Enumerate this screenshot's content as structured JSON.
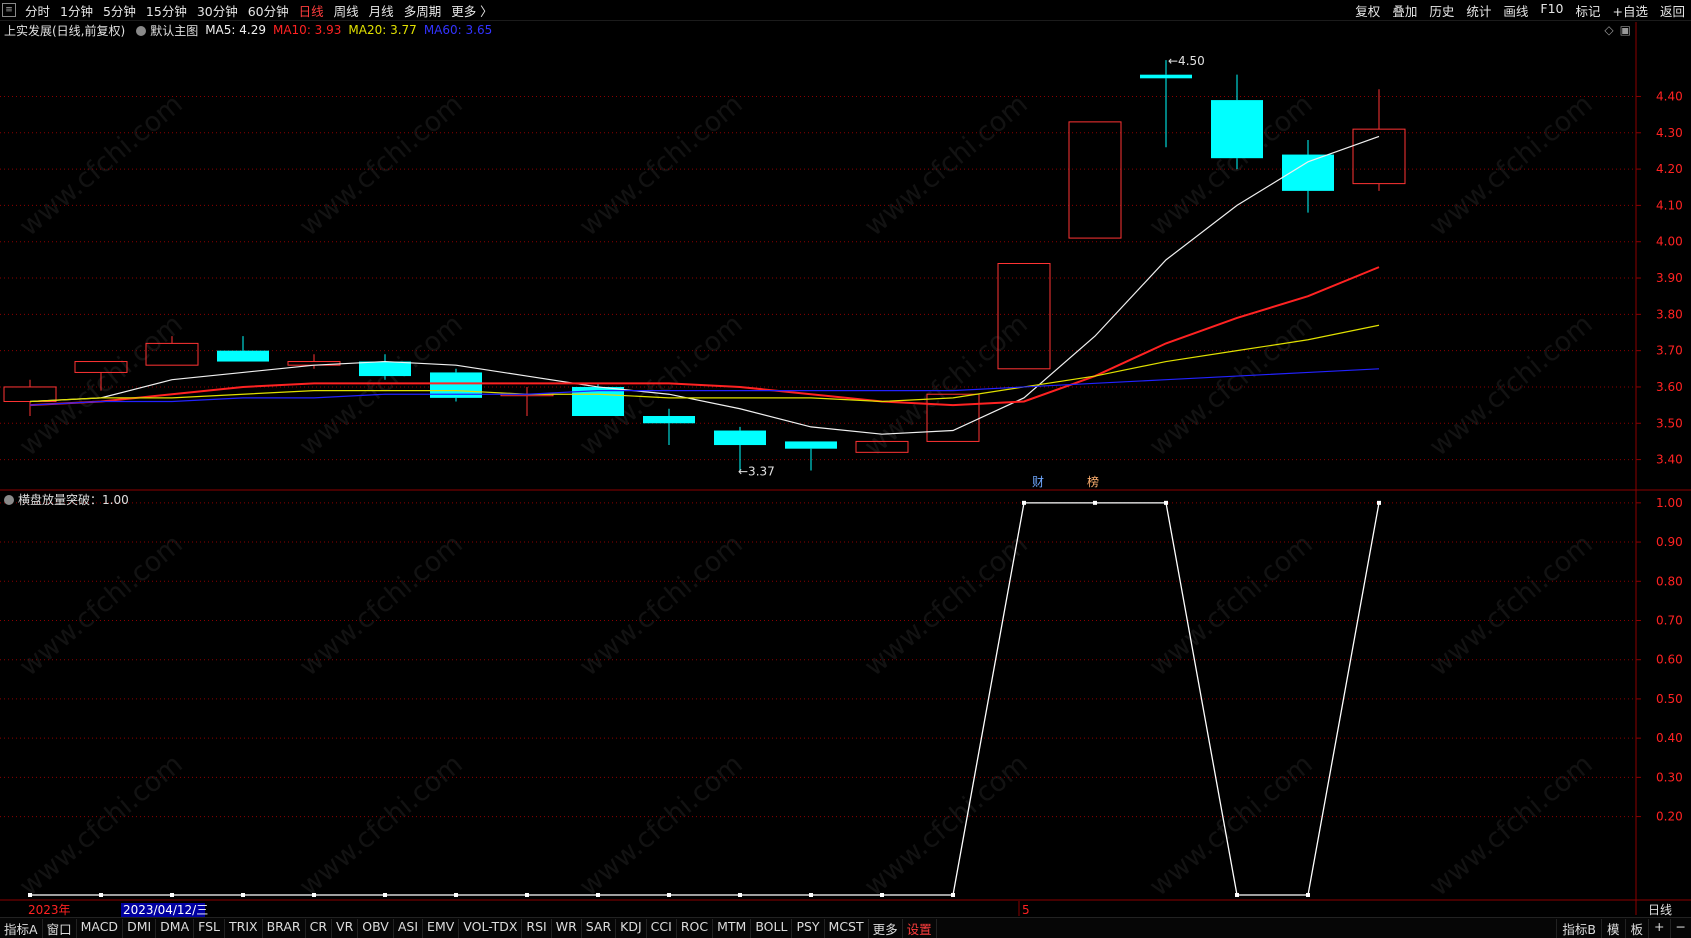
{
  "topbar": {
    "sys_icon": "menu-icon",
    "periods": [
      "分时",
      "1分钟",
      "5分钟",
      "15分钟",
      "30分钟",
      "60分钟",
      "日线",
      "周线",
      "月线",
      "多周期",
      "更多 〉"
    ],
    "active_period": "日线",
    "right_items": [
      "复权",
      "叠加",
      "历史",
      "统计",
      "画线",
      "F10",
      "标记",
      "+自选",
      "返回"
    ]
  },
  "legend": {
    "title": "上实发展(日线,前复权)",
    "main_label": "默认主图",
    "ma5": "MA5: 4.29",
    "ma10": "MA10: 3.93",
    "ma20": "MA20: 3.77",
    "ma60": "MA60: 3.65"
  },
  "indicator_legend": {
    "label": "横盘放量突破：1.00"
  },
  "markers": {
    "high_label": "4.50",
    "low_label": "3.37",
    "event1": "财",
    "event2": "榜"
  },
  "xaxis": {
    "year_label": "2023年",
    "date_label": "2023/04/12/三",
    "tick5": "5",
    "period_label": "日线"
  },
  "bottombar": {
    "tabs": [
      "指标A",
      "窗口",
      "MACD",
      "DMI",
      "DMA",
      "FSL",
      "TRIX",
      "BRAR",
      "CR",
      "VR",
      "OBV",
      "ASI",
      "EMV",
      "VOL-TDX",
      "RSI",
      "WR",
      "SAR",
      "KDJ",
      "CCI",
      "ROC",
      "MTM",
      "BOLL",
      "PSY",
      "MCST",
      "更多",
      "设置"
    ],
    "active_tab": "设置",
    "right_tabs": [
      "指标B",
      "模",
      "板",
      "+",
      "−"
    ]
  },
  "colors": {
    "up": "#ff3333",
    "down": "#00ffff",
    "ma5": "#f0f0f0",
    "ma10": "#ff2222",
    "ma20": "#e0e000",
    "ma60": "#2222ff",
    "grid": "#8b0000",
    "indicator": "#ffffff"
  },
  "watermark": "www.cfchi.com",
  "chart_data": [
    {
      "type": "candlestick",
      "ylim": [
        3.33,
        4.55
      ],
      "y_ticks": [
        3.4,
        3.5,
        3.6,
        3.7,
        3.8,
        3.9,
        4.0,
        4.1,
        4.2,
        4.3,
        4.4
      ],
      "candles": [
        {
          "o": 3.56,
          "h": 3.62,
          "l": 3.52,
          "c": 3.6
        },
        {
          "o": 3.64,
          "h": 3.67,
          "l": 3.59,
          "c": 3.67
        },
        {
          "o": 3.66,
          "h": 3.74,
          "l": 3.66,
          "c": 3.72
        },
        {
          "o": 3.7,
          "h": 3.74,
          "l": 3.68,
          "c": 3.67
        },
        {
          "o": 3.66,
          "h": 3.69,
          "l": 3.65,
          "c": 3.67
        },
        {
          "o": 3.67,
          "h": 3.69,
          "l": 3.62,
          "c": 3.63
        },
        {
          "o": 3.64,
          "h": 3.65,
          "l": 3.56,
          "c": 3.57
        },
        {
          "o": 3.58,
          "h": 3.6,
          "l": 3.52,
          "c": 3.58
        },
        {
          "o": 3.6,
          "h": 3.61,
          "l": 3.52,
          "c": 3.52
        },
        {
          "o": 3.52,
          "h": 3.54,
          "l": 3.44,
          "c": 3.5
        },
        {
          "o": 3.48,
          "h": 3.49,
          "l": 3.37,
          "c": 3.44
        },
        {
          "o": 3.45,
          "h": 3.45,
          "l": 3.37,
          "c": 3.43
        },
        {
          "o": 3.42,
          "h": 3.45,
          "l": 3.42,
          "c": 3.45
        },
        {
          "o": 3.45,
          "h": 3.58,
          "l": 3.45,
          "c": 3.58
        },
        {
          "o": 3.65,
          "h": 3.94,
          "l": 3.65,
          "c": 3.94
        },
        {
          "o": 4.01,
          "h": 4.33,
          "l": 4.01,
          "c": 4.33
        },
        {
          "o": 4.46,
          "h": 4.5,
          "l": 4.26,
          "c": 4.45
        },
        {
          "o": 4.39,
          "h": 4.46,
          "l": 4.2,
          "c": 4.23
        },
        {
          "o": 4.24,
          "h": 4.28,
          "l": 4.08,
          "c": 4.14
        },
        {
          "o": 4.16,
          "h": 4.42,
          "l": 4.14,
          "c": 4.31
        }
      ],
      "series": [
        {
          "name": "MA5",
          "values": [
            3.56,
            3.57,
            3.62,
            3.64,
            3.66,
            3.67,
            3.66,
            3.63,
            3.6,
            3.58,
            3.54,
            3.49,
            3.47,
            3.48,
            3.57,
            3.74,
            3.95,
            4.1,
            4.22,
            4.29
          ]
        },
        {
          "name": "MA10",
          "values": [
            3.55,
            3.56,
            3.58,
            3.6,
            3.61,
            3.61,
            3.61,
            3.61,
            3.61,
            3.61,
            3.6,
            3.58,
            3.56,
            3.55,
            3.56,
            3.63,
            3.72,
            3.79,
            3.85,
            3.93
          ]
        },
        {
          "name": "MA20",
          "values": [
            3.56,
            3.57,
            3.57,
            3.58,
            3.59,
            3.59,
            3.59,
            3.58,
            3.58,
            3.57,
            3.57,
            3.57,
            3.56,
            3.57,
            3.6,
            3.63,
            3.67,
            3.7,
            3.73,
            3.77
          ]
        },
        {
          "name": "MA60",
          "values": [
            3.55,
            3.56,
            3.56,
            3.57,
            3.57,
            3.58,
            3.58,
            3.58,
            3.59,
            3.59,
            3.59,
            3.59,
            3.59,
            3.59,
            3.6,
            3.61,
            3.62,
            3.63,
            3.64,
            3.65
          ]
        }
      ]
    },
    {
      "type": "line",
      "series": [
        {
          "name": "横盘放量突破",
          "values": [
            0,
            0,
            0,
            0,
            0,
            0,
            0,
            0,
            0,
            0,
            0,
            0,
            0,
            0,
            1,
            1,
            1,
            0,
            0,
            1
          ]
        }
      ],
      "ylim": [
        0,
        1.02
      ],
      "y_ticks": [
        0.2,
        0.3,
        0.4,
        0.5,
        0.6,
        0.7,
        0.8,
        0.9,
        1.0
      ]
    }
  ]
}
